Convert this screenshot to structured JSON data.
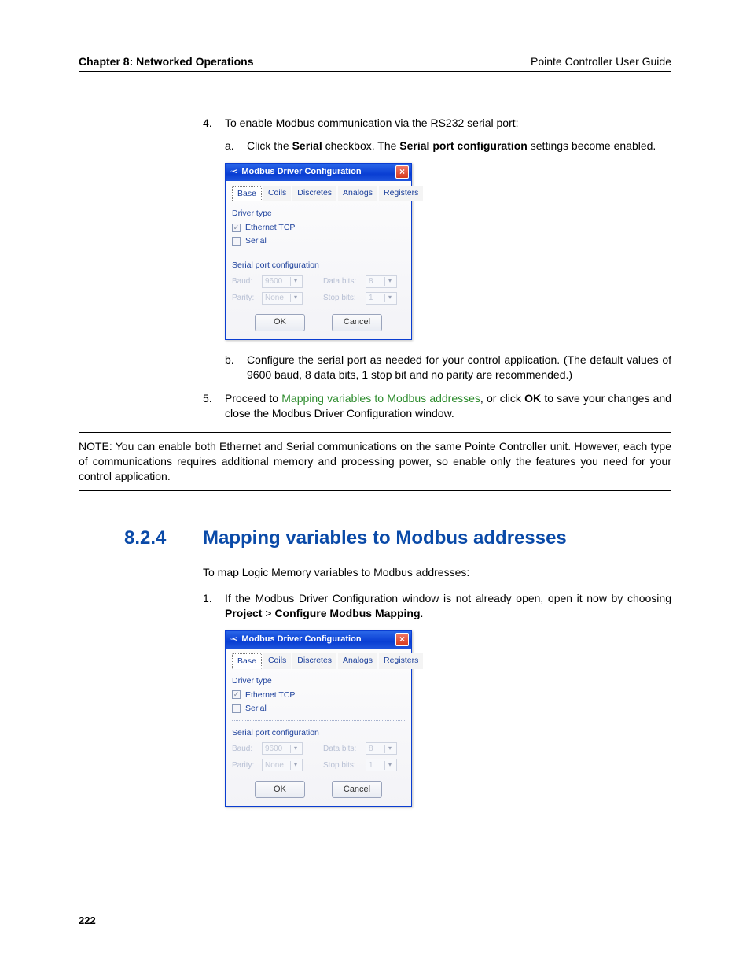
{
  "header": {
    "left": "Chapter 8: Networked Operations",
    "right": "Pointe Controller User Guide"
  },
  "steps": {
    "s4": {
      "num": "4.",
      "text": "To enable Modbus communication via the RS232 serial port:",
      "a": {
        "num": "a.",
        "pre": "Click the ",
        "b1": "Serial",
        "mid": " checkbox. The ",
        "b2": "Serial port configuration",
        "post": " settings become enabled."
      },
      "b": {
        "num": "b.",
        "text": "Configure the serial port as needed for your control application. (The default values of 9600 baud, 8 data bits, 1 stop bit and no parity are recommended.)"
      }
    },
    "s5": {
      "num": "5.",
      "pre": "Proceed to ",
      "link": "Mapping variables to Modbus addresses",
      "mid": ", or click ",
      "b1": "OK",
      "post": " to save your changes and close the Modbus Driver Configuration window."
    }
  },
  "note": "NOTE: You can enable both Ethernet and Serial communications on the same Pointe Controller unit. However, each type of communications requires additional memory and processing power, so enable only the features you need for your control application.",
  "section": {
    "num": "8.2.4",
    "title": "Mapping variables to Modbus addresses",
    "intro": "To map Logic Memory variables to Modbus addresses:",
    "s1": {
      "num": "1.",
      "pre": "If the Modbus Driver Configuration window is not already open, open it now by choosing ",
      "b1": "Project",
      "mid": " > ",
      "b2": "Configure Modbus Mapping",
      "post": "."
    }
  },
  "dialog": {
    "title": "Modbus Driver Configuration",
    "tabs": [
      "Base",
      "Coils",
      "Discretes",
      "Analogs",
      "Registers"
    ],
    "group1": "Driver type",
    "cb1": "Ethernet TCP",
    "cb2": "Serial",
    "group2": "Serial port configuration",
    "labels": {
      "baud": "Baud:",
      "parity": "Parity:",
      "databits": "Data bits:",
      "stopbits": "Stop bits:"
    },
    "values": {
      "baud": "9600",
      "parity": "None",
      "databits": "8",
      "stopbits": "1"
    },
    "ok": "OK",
    "cancel": "Cancel"
  },
  "footer": {
    "page": "222"
  }
}
